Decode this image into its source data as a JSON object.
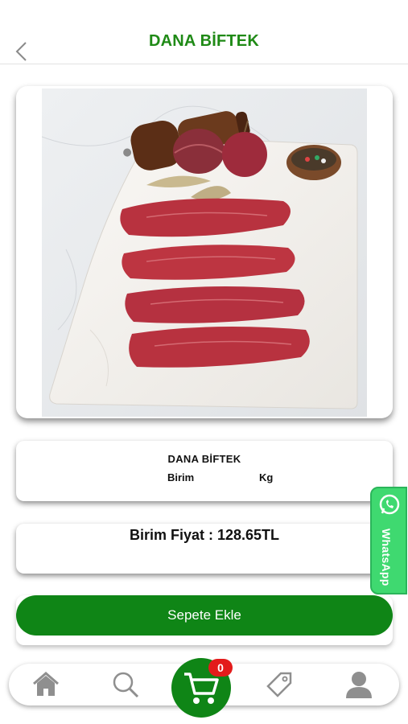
{
  "header": {
    "title": "DANA BİFTEK",
    "back_icon": "chevron-left-icon"
  },
  "product": {
    "image_alt": "Dana biftek",
    "name": "DANA BİFTEK",
    "unit_label": "Birim",
    "unit_value": "Kg",
    "price_text": "Birim Fiyat : 128.65TL"
  },
  "whatsapp": {
    "label": "WhatsApp",
    "icon": "whatsapp-icon",
    "color": "#3fd970"
  },
  "actions": {
    "add_to_cart_label": "Sepete Ekle"
  },
  "tabbar": {
    "items": [
      {
        "name": "home",
        "icon": "home-icon"
      },
      {
        "name": "search",
        "icon": "search-icon"
      },
      {
        "name": "cart",
        "icon": "cart-icon"
      },
      {
        "name": "tag",
        "icon": "tag-icon"
      },
      {
        "name": "profile",
        "icon": "user-icon"
      }
    ],
    "cart_count": "0"
  },
  "colors": {
    "brand_green": "#0f8516",
    "title_green": "#1f8a16",
    "badge_red": "#e31b1b"
  }
}
